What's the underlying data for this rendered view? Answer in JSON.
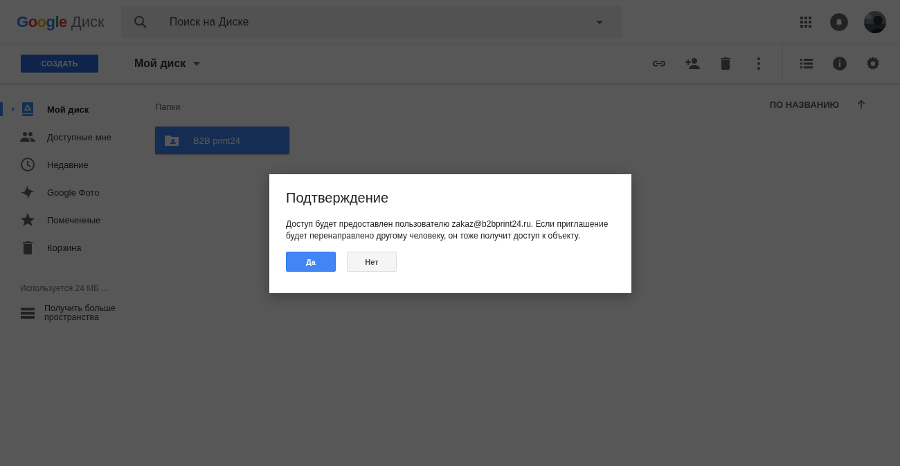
{
  "header": {
    "logo": "Google",
    "product": "Диск",
    "search": {
      "placeholder": "Поиск на Диске"
    }
  },
  "toolbar": {
    "create_button": "СОЗДАТЬ",
    "location": "Мой диск"
  },
  "sidebar": {
    "items": [
      {
        "label": "Мой диск",
        "selected": true
      },
      {
        "label": "Доступные мне",
        "selected": false
      },
      {
        "label": "Недавние",
        "selected": false
      },
      {
        "label": "Google Фото",
        "selected": false
      },
      {
        "label": "Помеченные",
        "selected": false
      },
      {
        "label": "Корзина",
        "selected": false
      }
    ],
    "storage": "Используется 24 МБ ...",
    "upgrade": "Получить больше пространства"
  },
  "main": {
    "section": "Папки",
    "sort": "ПО НАЗВАНИЮ",
    "folders": [
      {
        "name": "B2B print24",
        "selected": true
      }
    ]
  },
  "dialog": {
    "title": "Подтверждение",
    "message": "Доступ будет предоставлен пользователю zakaz@b2bprint24.ru. Если приглашение будет перенаправлено другому человеку, он тоже получит доступ к объекту.",
    "buttons": [
      {
        "label": "Да",
        "kind": "primary"
      },
      {
        "label": "Нет",
        "kind": "secondary"
      }
    ]
  }
}
